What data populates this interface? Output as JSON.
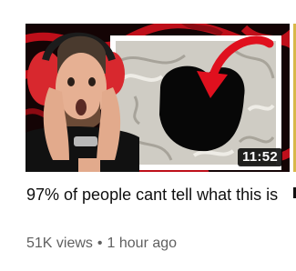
{
  "video": {
    "title": "97% of people cant tell what this is",
    "duration": "11:52",
    "views": "51K views",
    "separator": "•",
    "age": "1 hour ago"
  },
  "colors": {
    "title_text": "#0f0f0f",
    "meta_text": "#606060",
    "thumbnail_accent": "#e0101e",
    "duration_bg": "#000000"
  },
  "icons": {
    "thumbnail_arrow": "curved-arrow-icon"
  }
}
